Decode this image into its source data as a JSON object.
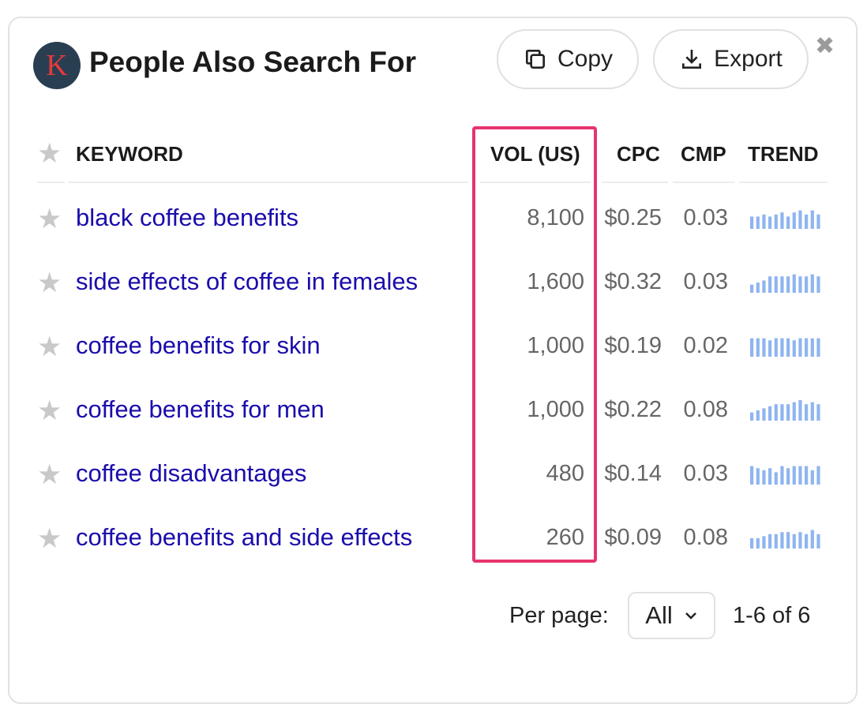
{
  "header": {
    "logo_letter": "K",
    "title": "People Also Search For",
    "copy_label": "Copy",
    "export_label": "Export",
    "icons": {
      "copy": "copy-icon",
      "export": "download-icon",
      "close": "close-icon",
      "favorite": "star-icon"
    }
  },
  "table": {
    "columns": {
      "keyword": "KEYWORD",
      "vol": "VOL (US)",
      "cpc": "CPC",
      "cmp": "CMP",
      "trend": "TREND"
    },
    "rows": [
      {
        "keyword": "black coffee benefits",
        "vol": "8,100",
        "cpc": "$0.25",
        "cmp": "0.03",
        "trend": [
          6,
          6,
          7,
          6,
          7,
          8,
          6,
          8,
          9,
          7,
          9,
          7
        ]
      },
      {
        "keyword": "side effects of coffee in females",
        "vol": "1,600",
        "cpc": "$0.32",
        "cmp": "0.03",
        "trend": [
          4,
          5,
          6,
          8,
          8,
          8,
          8,
          9,
          8,
          8,
          9,
          8
        ]
      },
      {
        "keyword": "coffee benefits for skin",
        "vol": "1,000",
        "cpc": "$0.19",
        "cmp": "0.02",
        "trend": [
          9,
          9,
          9,
          8,
          9,
          9,
          9,
          8,
          9,
          9,
          9,
          9
        ]
      },
      {
        "keyword": "coffee benefits for men",
        "vol": "1,000",
        "cpc": "$0.22",
        "cmp": "0.08",
        "trend": [
          4,
          5,
          6,
          7,
          8,
          8,
          8,
          9,
          10,
          8,
          9,
          8
        ]
      },
      {
        "keyword": "coffee disadvantages",
        "vol": "480",
        "cpc": "$0.14",
        "cmp": "0.03",
        "trend": [
          9,
          8,
          7,
          8,
          6,
          9,
          8,
          9,
          9,
          9,
          7,
          9
        ]
      },
      {
        "keyword": "coffee benefits and side effects",
        "vol": "260",
        "cpc": "$0.09",
        "cmp": "0.08",
        "trend": [
          5,
          5,
          6,
          7,
          7,
          8,
          8,
          7,
          8,
          7,
          9,
          7
        ]
      }
    ]
  },
  "footer": {
    "per_page_label": "Per page:",
    "per_page_value": "All",
    "range": "1-6 of 6"
  },
  "colors": {
    "highlight": "#e8356d",
    "link": "#1a0dab",
    "trend_bar": "#8fb5f0"
  }
}
